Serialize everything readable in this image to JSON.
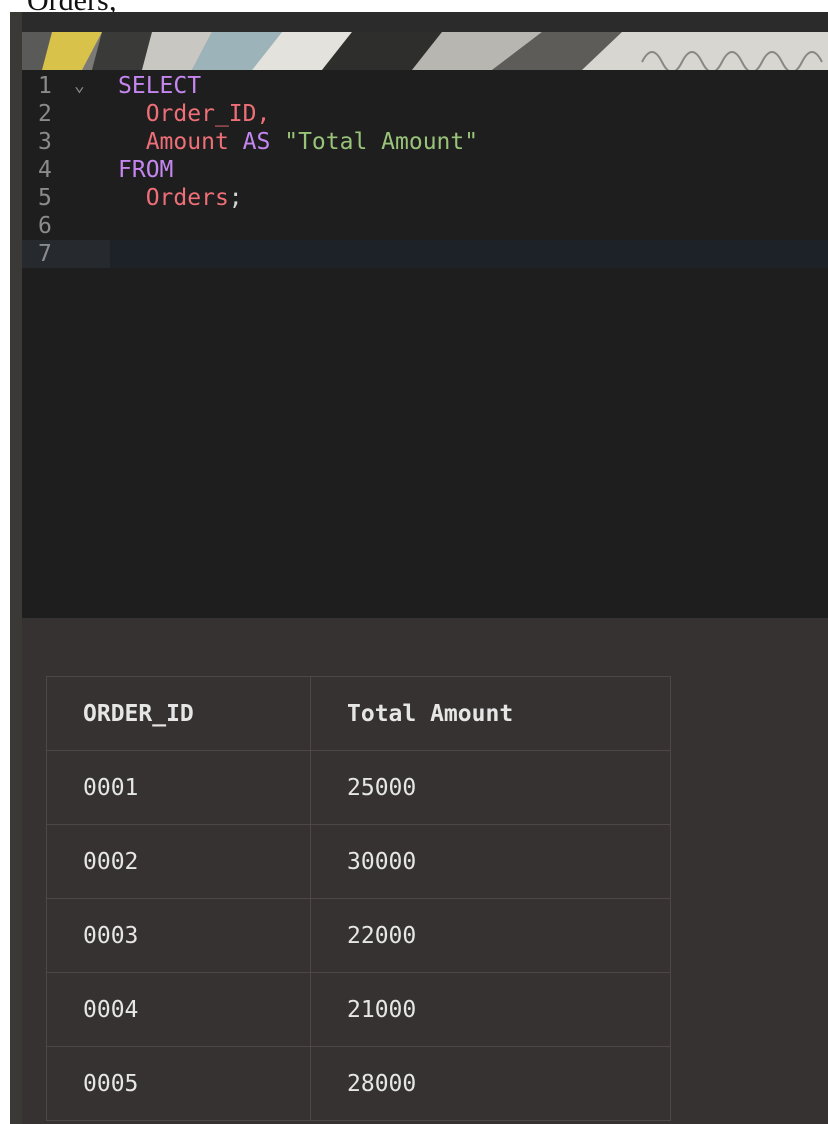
{
  "top_text": "Orders;",
  "editor": {
    "lines": [
      {
        "n": "1",
        "fold": "⌄",
        "tokens": [
          {
            "t": "SELECT",
            "c": "kw"
          }
        ]
      },
      {
        "n": "2",
        "fold": "",
        "tokens": [
          {
            "t": "  "
          },
          {
            "t": "Order_ID",
            "c": "id"
          },
          {
            "t": ",",
            "c": "id"
          }
        ]
      },
      {
        "n": "3",
        "fold": "",
        "tokens": [
          {
            "t": "  "
          },
          {
            "t": "Amount",
            "c": "id"
          },
          {
            "t": " "
          },
          {
            "t": "AS",
            "c": "kw"
          },
          {
            "t": " "
          },
          {
            "t": "\"Total Amount\"",
            "c": "str"
          }
        ]
      },
      {
        "n": "4",
        "fold": "",
        "tokens": [
          {
            "t": "FROM",
            "c": "kw"
          }
        ]
      },
      {
        "n": "5",
        "fold": "",
        "tokens": [
          {
            "t": "  "
          },
          {
            "t": "Orders",
            "c": "id"
          },
          {
            "t": ";",
            "c": "pl"
          }
        ]
      },
      {
        "n": "6",
        "fold": "",
        "tokens": []
      },
      {
        "n": "7",
        "fold": "",
        "tokens": [],
        "active": true
      }
    ]
  },
  "results": {
    "columns": [
      "ORDER_ID",
      "Total Amount"
    ],
    "rows": [
      [
        "0001",
        "25000"
      ],
      [
        "0002",
        "30000"
      ],
      [
        "0003",
        "22000"
      ],
      [
        "0004",
        "21000"
      ],
      [
        "0005",
        "28000"
      ]
    ]
  },
  "colors": {
    "keyword": "#c586f0",
    "identifier": "#ef6f78",
    "string": "#98c379",
    "editor_bg": "#1e1e1e",
    "results_bg": "#363231"
  }
}
